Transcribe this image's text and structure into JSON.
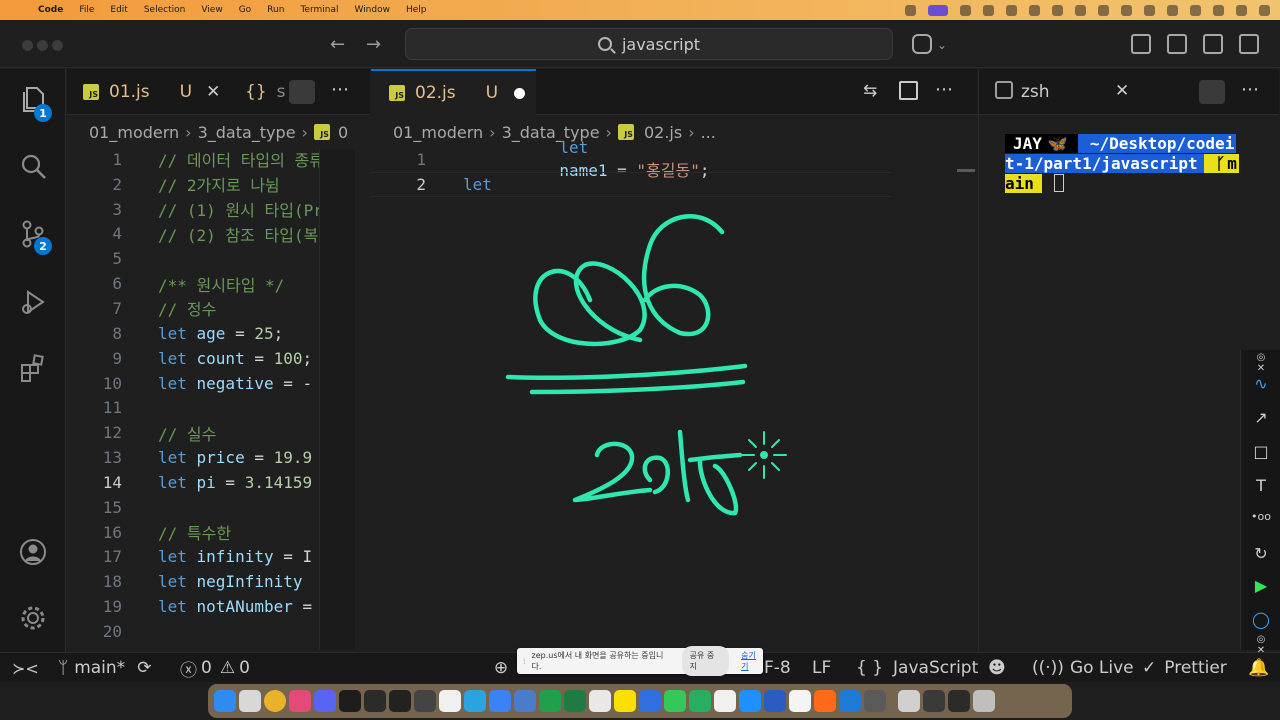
{
  "menubar": {
    "app": "Code",
    "items": [
      "File",
      "Edit",
      "Selection",
      "View",
      "Go",
      "Run",
      "Terminal",
      "Window",
      "Help"
    ]
  },
  "titlebar": {
    "search": "javascript"
  },
  "activity": {
    "explorer_badge": "1",
    "scm_badge": "2"
  },
  "left_group": {
    "tab1": {
      "name": "01.js",
      "status": "U"
    },
    "breadcrumb": [
      "01_modern",
      "3_data_type",
      "0"
    ],
    "lines": [
      {
        "n": "1",
        "kind": "cm",
        "text": "// 데이터 타입의 종류"
      },
      {
        "n": "2",
        "kind": "cm",
        "text": "// 2가지로 나뉨"
      },
      {
        "n": "3",
        "kind": "cm",
        "text": "// (1) 원시 타입(Pr"
      },
      {
        "n": "4",
        "kind": "cm",
        "text": "// (2) 참조 타입(복"
      },
      {
        "n": "5",
        "kind": "blank",
        "text": ""
      },
      {
        "n": "6",
        "kind": "cm",
        "text": "/** 원시타입 */"
      },
      {
        "n": "7",
        "kind": "cm",
        "text": "// 정수"
      },
      {
        "n": "8",
        "kind": "let",
        "name": "age",
        "rest": " = ",
        "val": "25",
        "tail": ";"
      },
      {
        "n": "9",
        "kind": "let",
        "name": "count",
        "rest": " = ",
        "val": "100",
        "tail": ";"
      },
      {
        "n": "10",
        "kind": "let",
        "name": "negative",
        "rest": " = -",
        "val": "",
        "tail": ""
      },
      {
        "n": "11",
        "kind": "blank",
        "text": ""
      },
      {
        "n": "12",
        "kind": "cm",
        "text": "// 실수"
      },
      {
        "n": "13",
        "kind": "let",
        "name": "price",
        "rest": " = ",
        "val": "19.9",
        "tail": ""
      },
      {
        "n": "14",
        "kind": "let",
        "name": "pi",
        "rest": " = ",
        "val": "3.14159",
        "tail": ""
      },
      {
        "n": "15",
        "kind": "blank",
        "text": ""
      },
      {
        "n": "16",
        "kind": "cm",
        "text": "// 특수한"
      },
      {
        "n": "17",
        "kind": "let",
        "name": "infinity",
        "rest": " = I",
        "val": "",
        "tail": ""
      },
      {
        "n": "18",
        "kind": "let",
        "name": "negInfinity",
        "rest": "",
        "val": "",
        "tail": ""
      },
      {
        "n": "19",
        "kind": "let",
        "name": "notANumber",
        "rest": " =",
        "val": "",
        "tail": ""
      },
      {
        "n": "20",
        "kind": "blank",
        "text": ""
      }
    ]
  },
  "right_group": {
    "tab": {
      "name": "02.js",
      "status": "U"
    },
    "breadcrumb": [
      "01_modern",
      "3_data_type",
      "02.js",
      "..."
    ],
    "line1": {
      "n": "1",
      "kw": "let",
      "name": "name1",
      "eq": " = ",
      "str": "\"홍길동\"",
      "semi": ";"
    },
    "line2": {
      "n": "2",
      "kw": "let"
    }
  },
  "terminal": {
    "tab": "zsh",
    "user": "JAY",
    "path1": "~/Desktop/codei",
    "path2": "t-1/part1/javascript",
    "branch1": "m",
    "branch2": "ain"
  },
  "statusbar": {
    "branch": "main*",
    "errors": "0",
    "warnings": "0",
    "encoding": "F-8",
    "eol": "LF",
    "language": "JavaScript",
    "golive": "Go Live",
    "prettier": "Prettier"
  },
  "share": {
    "message": "zep.us에서 내 화면을 공유하는 중입니다.",
    "stop": "공유 중지",
    "hide": "숨기기"
  },
  "colors": {
    "ink": "#2ee8b0",
    "accent": "#0078d4",
    "keyword": "#569cd6",
    "comment": "#6a9955"
  }
}
